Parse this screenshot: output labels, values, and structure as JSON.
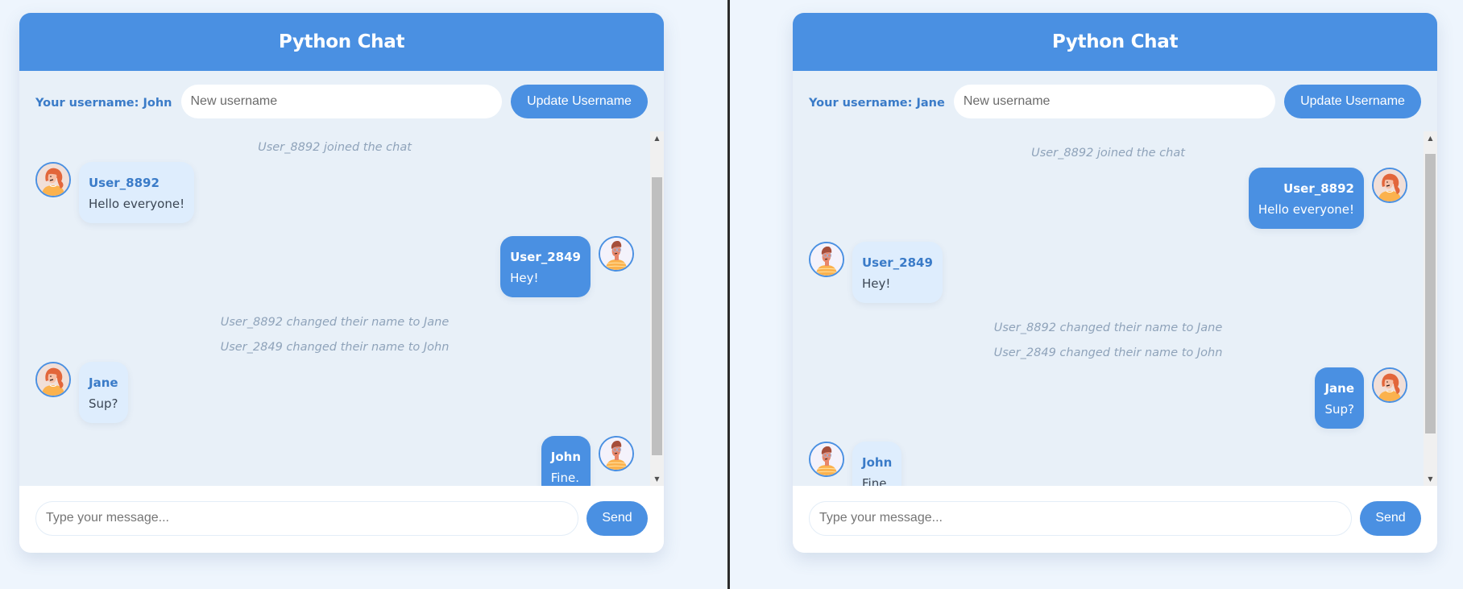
{
  "theme": {
    "accent": "#4a90e2",
    "page_bg": "#eef5fd",
    "panel_bg": "#e8f0f8",
    "other_bubble_bg": "#deedfd",
    "system_text": "#8fa3ba"
  },
  "windows": [
    {
      "title": "Python Chat",
      "username_label": "Your username: John",
      "username_placeholder": "New username",
      "update_button": "Update Username",
      "message_placeholder": "Type your message...",
      "send_button": "Send",
      "scroll_position": "bottom",
      "messages": [
        {
          "type": "system",
          "text": "User_8892 joined the chat"
        },
        {
          "type": "chat",
          "side": "other",
          "avatar": "woman-avatar",
          "name": "User_8892",
          "text": "Hello everyone!"
        },
        {
          "type": "chat",
          "side": "own",
          "avatar": "man-avatar",
          "name": "User_2849",
          "text": "Hey!"
        },
        {
          "type": "system",
          "text": "User_8892 changed their name to Jane"
        },
        {
          "type": "system",
          "text": "User_2849 changed their name to John"
        },
        {
          "type": "chat",
          "side": "other",
          "avatar": "woman-avatar",
          "name": "Jane",
          "text": "Sup?"
        },
        {
          "type": "chat",
          "side": "own",
          "avatar": "man-avatar",
          "name": "John",
          "text": "Fine."
        }
      ]
    },
    {
      "title": "Python Chat",
      "username_label": "Your username: Jane",
      "username_placeholder": "New username",
      "update_button": "Update Username",
      "message_placeholder": "Type your message...",
      "send_button": "Send",
      "scroll_position": "bottom",
      "messages": [
        {
          "type": "system",
          "text": "User_8892 joined the chat"
        },
        {
          "type": "chat",
          "side": "own",
          "avatar": "woman-avatar",
          "name": "User_8892",
          "text": "Hello everyone!"
        },
        {
          "type": "chat",
          "side": "other",
          "avatar": "man-avatar",
          "name": "User_2849",
          "text": "Hey!"
        },
        {
          "type": "system",
          "text": "User_8892 changed their name to Jane"
        },
        {
          "type": "system",
          "text": "User_2849 changed their name to John"
        },
        {
          "type": "chat",
          "side": "own",
          "avatar": "woman-avatar",
          "name": "Jane",
          "text": "Sup?"
        },
        {
          "type": "chat",
          "side": "other",
          "avatar": "man-avatar",
          "name": "John",
          "text": "Fine."
        }
      ]
    }
  ]
}
